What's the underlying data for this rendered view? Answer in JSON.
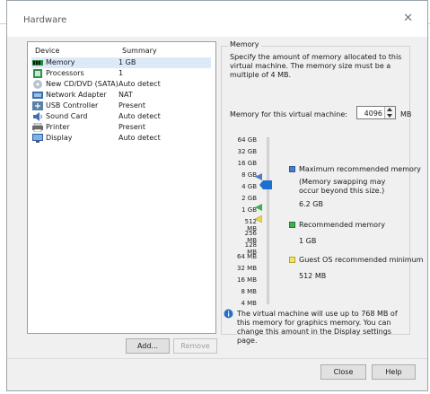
{
  "dialog": {
    "title": "Hardware"
  },
  "devices": {
    "header_device": "Device",
    "header_summary": "Summary",
    "items": [
      {
        "device": "Memory",
        "summary": "1 GB",
        "icon": "memory-icon"
      },
      {
        "device": "Processors",
        "summary": "1",
        "icon": "processor-icon"
      },
      {
        "device": "New CD/DVD (SATA)",
        "summary": "Auto detect",
        "icon": "cd-dvd-icon"
      },
      {
        "device": "Network Adapter",
        "summary": "NAT",
        "icon": "network-adapter-icon"
      },
      {
        "device": "USB Controller",
        "summary": "Present",
        "icon": "usb-icon"
      },
      {
        "device": "Sound Card",
        "summary": "Auto detect",
        "icon": "speaker-icon"
      },
      {
        "device": "Printer",
        "summary": "Present",
        "icon": "printer-icon"
      },
      {
        "device": "Display",
        "summary": "Auto detect",
        "icon": "monitor-icon"
      }
    ],
    "add_label": "Add...",
    "remove_label": "Remove"
  },
  "memory": {
    "group_title": "Memory",
    "description": "Specify the amount of memory allocated to this virtual machine. The memory size must be a multiple of 4 MB.",
    "field_label": "Memory for this virtual machine:",
    "field_value": "4096",
    "unit": "MB",
    "scale_ticks": [
      "64 GB",
      "32 GB",
      "16 GB",
      "8 GB",
      "4 GB",
      "2 GB",
      "1 GB",
      "512 MB",
      "256 MB",
      "128 MB",
      "64 MB",
      "32 MB",
      "16 MB",
      "8 MB",
      "4 MB"
    ],
    "slider_value": "4 GB",
    "max_label": "Maximum recommended memory",
    "max_note": "(Memory swapping may occur beyond this size.)",
    "max_value": "6.2 GB",
    "rec_label": "Recommended memory",
    "rec_value": "1 GB",
    "guest_label": "Guest OS recommended minimum",
    "guest_value": "512 MB",
    "info_text": "The virtual machine will use up to 768 MB of this memory for graphics memory. You can change this amount in the Display settings page.",
    "colors": {
      "max": "#4a7ec8",
      "rec": "#3cb04a",
      "guest": "#e6d84a",
      "thumb": "#1e6fd0"
    }
  },
  "footer": {
    "close_label": "Close",
    "help_label": "Help"
  },
  "side_marker": "1"
}
